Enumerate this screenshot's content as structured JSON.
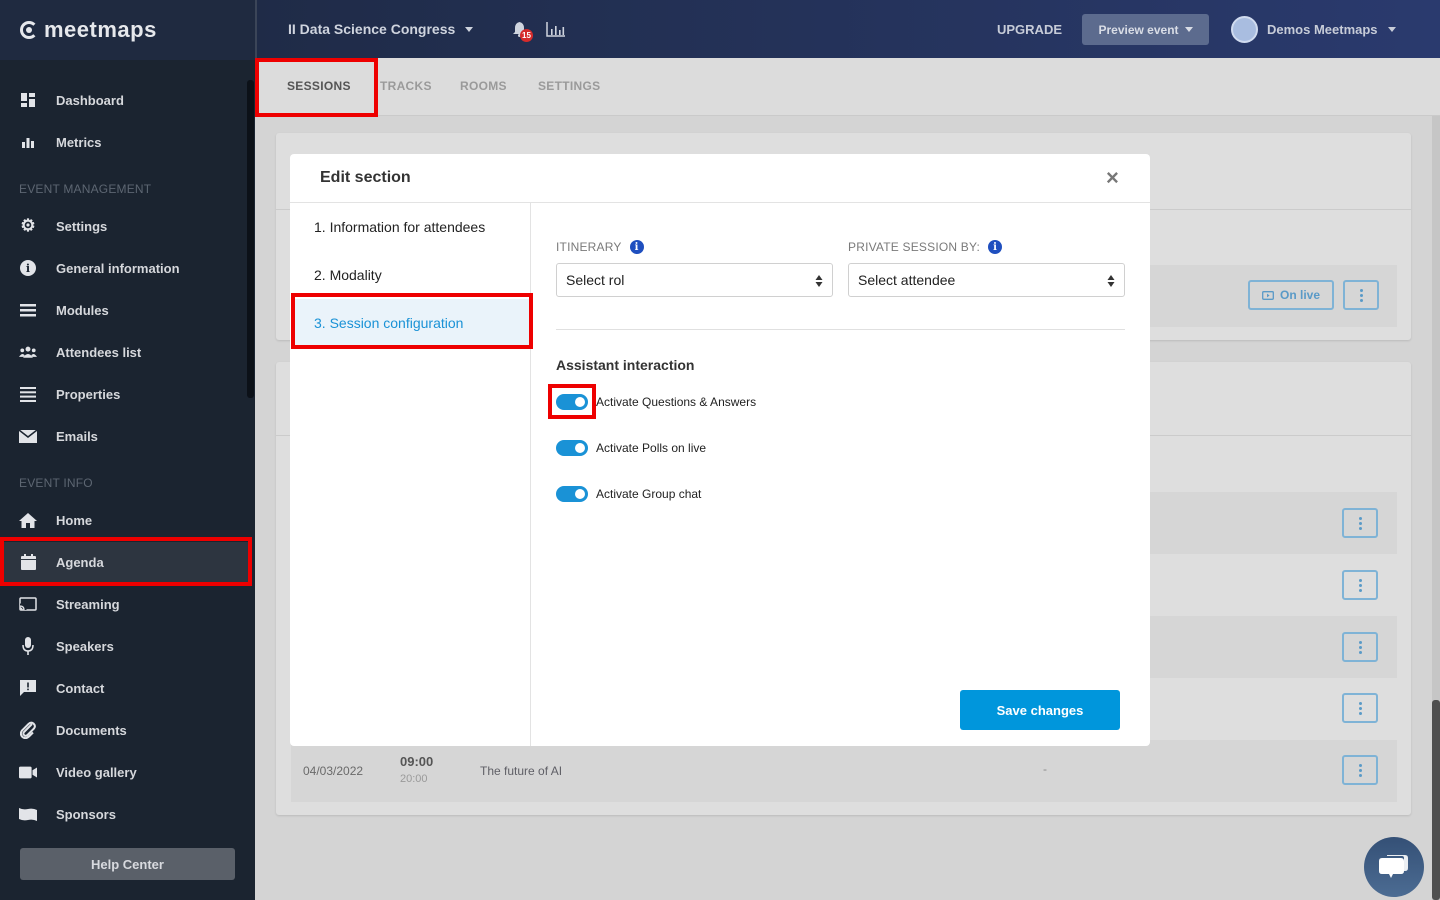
{
  "brand": {
    "name": "meetmaps"
  },
  "sidebar": {
    "items_top": [
      {
        "label": "Dashboard",
        "icon": "dashboard-icon"
      },
      {
        "label": "Metrics",
        "icon": "bar-chart-icon"
      }
    ],
    "section_management": "EVENT MANAGEMENT",
    "items_management": [
      {
        "label": "Settings",
        "icon": "gear-icon"
      },
      {
        "label": "General information",
        "icon": "info-icon"
      },
      {
        "label": "Modules",
        "icon": "menu-icon"
      },
      {
        "label": "Attendees list",
        "icon": "users-icon"
      },
      {
        "label": "Properties",
        "icon": "list-icon"
      },
      {
        "label": "Emails",
        "icon": "envelope-icon"
      }
    ],
    "section_info": "EVENT INFO",
    "items_info": [
      {
        "label": "Home",
        "icon": "home-icon"
      },
      {
        "label": "Agenda",
        "icon": "calendar-icon",
        "active": true
      },
      {
        "label": "Streaming",
        "icon": "cast-icon"
      },
      {
        "label": "Speakers",
        "icon": "microphone-icon"
      },
      {
        "label": "Contact",
        "icon": "message-alert-icon"
      },
      {
        "label": "Documents",
        "icon": "paperclip-icon"
      },
      {
        "label": "Video gallery",
        "icon": "video-camera-icon"
      },
      {
        "label": "Sponsors",
        "icon": "flag-icon"
      }
    ],
    "help_center": "Help Center"
  },
  "topbar": {
    "event_title": "II Data Science Congress",
    "notifications_count": "15",
    "upgrade": "UPGRADE",
    "preview_event": "Preview event",
    "user_name": "Demos Meetmaps"
  },
  "tabs": [
    {
      "label": "SESSIONS",
      "active": true
    },
    {
      "label": "TRACKS"
    },
    {
      "label": "ROOMS"
    },
    {
      "label": "SETTINGS"
    }
  ],
  "background": {
    "on_live": "On live",
    "last_row": {
      "date": "04/03/2022",
      "start": "09:00",
      "end": "20:00",
      "title": "The future of AI",
      "dash": "-"
    }
  },
  "modal": {
    "title": "Edit section",
    "steps": [
      {
        "label": "1. Information for attendees"
      },
      {
        "label": "2. Modality"
      },
      {
        "label": "3. Session configuration",
        "active": true
      }
    ],
    "itinerary": {
      "label": "ITINERARY",
      "value": "Select rol"
    },
    "private_session": {
      "label": "PRIVATE SESSION BY:",
      "value": "Select attendee"
    },
    "assistant_interaction": {
      "title": "Assistant interaction",
      "toggles": [
        {
          "label": "Activate Questions & Answers",
          "on": true
        },
        {
          "label": "Activate Polls on live",
          "on": true
        },
        {
          "label": "Activate Group chat",
          "on": true
        }
      ]
    },
    "save": "Save changes"
  },
  "colors": {
    "accent": "#1a92d6",
    "save_button": "#0096dc",
    "highlight": "#e00000",
    "sidebar_bg": "#1b2430"
  }
}
